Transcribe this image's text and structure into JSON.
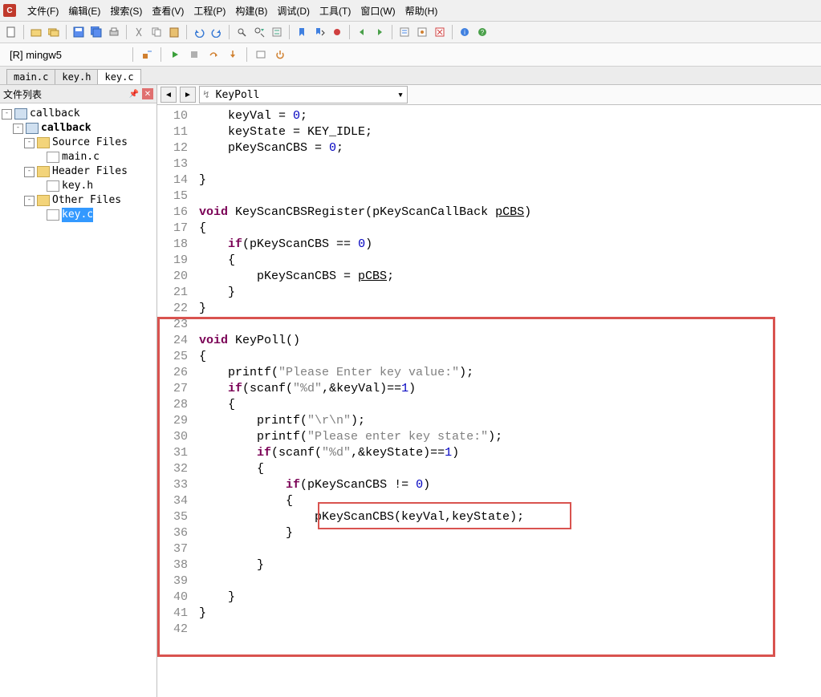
{
  "app_icon": "C",
  "menu": {
    "file": "文件(F)",
    "edit": "编辑(E)",
    "search": "搜索(S)",
    "view": "查看(V)",
    "project": "工程(P)",
    "build": "构建(B)",
    "debug": "调试(D)",
    "tool": "工具(T)",
    "window": "窗口(W)",
    "help": "帮助(H)"
  },
  "target": "[R] mingw5",
  "tabs": {
    "t1": "main.c",
    "t2": "key.h",
    "t3": "key.c"
  },
  "sidebar": {
    "title": "文件列表",
    "tree": {
      "root": "callback",
      "proj": "callback",
      "g1": "Source Files",
      "g1f1": "main.c",
      "g2": "Header Files",
      "g2f1": "key.h",
      "g3": "Other Files",
      "g3f1": "key.c"
    }
  },
  "funcbar": {
    "icon": "↯",
    "value": "KeyPoll",
    "arrow": "▾"
  },
  "glines": {
    "l10": "10",
    "l11": "11",
    "l12": "12",
    "l13": "13",
    "l14": "14",
    "l15": "15",
    "l16": "16",
    "l17": "17",
    "l18": "18",
    "l19": "19",
    "l20": "20",
    "l21": "21",
    "l22": "22",
    "l23": "23",
    "l24": "24",
    "l25": "25",
    "l26": "26",
    "l27": "27",
    "l28": "28",
    "l29": "29",
    "l30": "30",
    "l31": "31",
    "l32": "32",
    "l33": "33",
    "l34": "34",
    "l35": "35",
    "l36": "36",
    "l37": "37",
    "l38": "38",
    "l39": "39",
    "l40": "40",
    "l41": "41",
    "l42": "42"
  },
  "code": {
    "l10p1": "    keyVal = ",
    "l10n": "0",
    "l10p2": ";",
    "l11p1": "    keyState = KEY_IDLE;",
    "l12p1": "    pKeyScanCBS = ",
    "l12n": "0",
    "l12p2": ";",
    "l13": "",
    "l14": "}",
    "l15": "",
    "l16k": "void",
    "l16p1": " ",
    "l16fn": "KeyScanCBSRegister",
    "l16p2": "(pKeyScanCallBack ",
    "l16ul": "pCBS",
    "l16p3": ")",
    "l17": "{",
    "l18p1": "    ",
    "l18k": "if",
    "l18p2": "(pKeyScanCBS == ",
    "l18n": "0",
    "l18p3": ")",
    "l19": "    {",
    "l20p1": "        pKeyScanCBS = ",
    "l20ul": "pCBS",
    "l20p2": ";",
    "l21": "    }",
    "l22": "}",
    "l23": "",
    "l24k": "void",
    "l24p1": " ",
    "l24fn": "KeyPoll",
    "l24p2": "()",
    "l25": "{",
    "l26p1": "    printf(",
    "l26s": "\"Please Enter key value:\"",
    "l26p2": ");",
    "l27p1": "    ",
    "l27k": "if",
    "l27p2": "(scanf(",
    "l27s": "\"%d\"",
    "l27p3": ",&keyVal)==",
    "l27n": "1",
    "l27p4": ")",
    "l28": "    {",
    "l29p1": "        printf(",
    "l29s": "\"\\r\\n\"",
    "l29p2": ");",
    "l30p1": "        printf(",
    "l30s": "\"Please enter key state:\"",
    "l30p2": ");",
    "l31p1": "        ",
    "l31k": "if",
    "l31p2": "(scanf(",
    "l31s": "\"%d\"",
    "l31p3": ",&keyState)==",
    "l31n": "1",
    "l31p4": ")",
    "l32": "        {",
    "l33p1": "            ",
    "l33k": "if",
    "l33p2": "(pKeyScanCBS != ",
    "l33n": "0",
    "l33p3": ")",
    "l34": "            {",
    "l35": "                pKeyScanCBS(keyVal,keyState);",
    "l36": "            }",
    "l37": "",
    "l38": "        }",
    "l39": "",
    "l40": "    }",
    "l41": "}",
    "l42": ""
  }
}
